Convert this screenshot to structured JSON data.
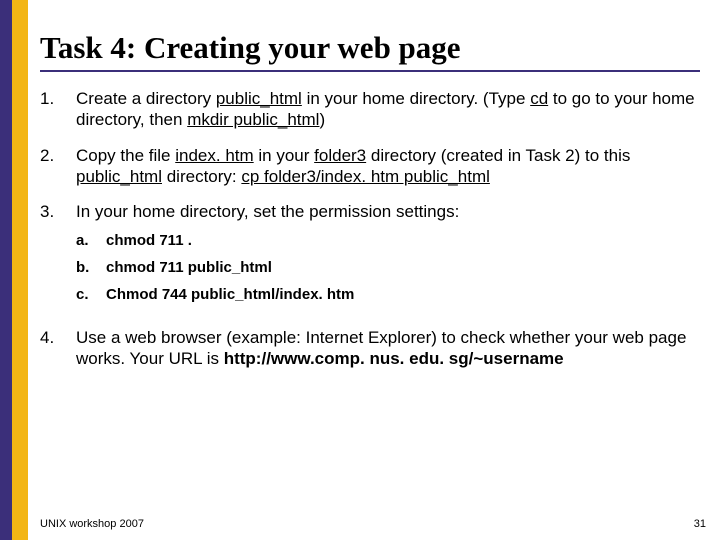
{
  "title": "Task 4: Creating your web page",
  "items": [
    {
      "num": "1.",
      "parts": [
        {
          "t": "Create a directory "
        },
        {
          "t": "public_html",
          "u": true
        },
        {
          "t": " in your home directory. (Type "
        },
        {
          "t": "cd",
          "u": true
        },
        {
          "t": " to go to your home directory, then "
        },
        {
          "t": "mkdir public_html",
          "u": true
        },
        {
          "t": ")"
        }
      ]
    },
    {
      "num": "2.",
      "parts": [
        {
          "t": "Copy the file "
        },
        {
          "t": "index. htm",
          "u": true
        },
        {
          "t": " in your "
        },
        {
          "t": "folder3",
          "u": true
        },
        {
          "t": " directory (created in Task 2) to this "
        },
        {
          "t": "public_html",
          "u": true
        },
        {
          "t": " directory: "
        },
        {
          "t": "cp folder3/index. htm public_html",
          "u": true
        }
      ]
    },
    {
      "num": "3.",
      "parts": [
        {
          "t": "In your home directory, set the permission settings:"
        }
      ],
      "sub": [
        {
          "snum": "a.",
          "text": "chmod 711 ."
        },
        {
          "snum": "b.",
          "text": "chmod 711 public_html"
        },
        {
          "snum": "c.",
          "text": "Chmod 744 public_html/index. htm"
        }
      ]
    },
    {
      "num": "4.",
      "parts": [
        {
          "t": "Use a web browser (example: Internet Explorer) to check whether your web page works. Your URL is "
        },
        {
          "t": "http://www.comp. nus. edu. sg/~username",
          "b": true
        }
      ]
    }
  ],
  "footer": "UNIX workshop 2007",
  "pagenum": "31"
}
